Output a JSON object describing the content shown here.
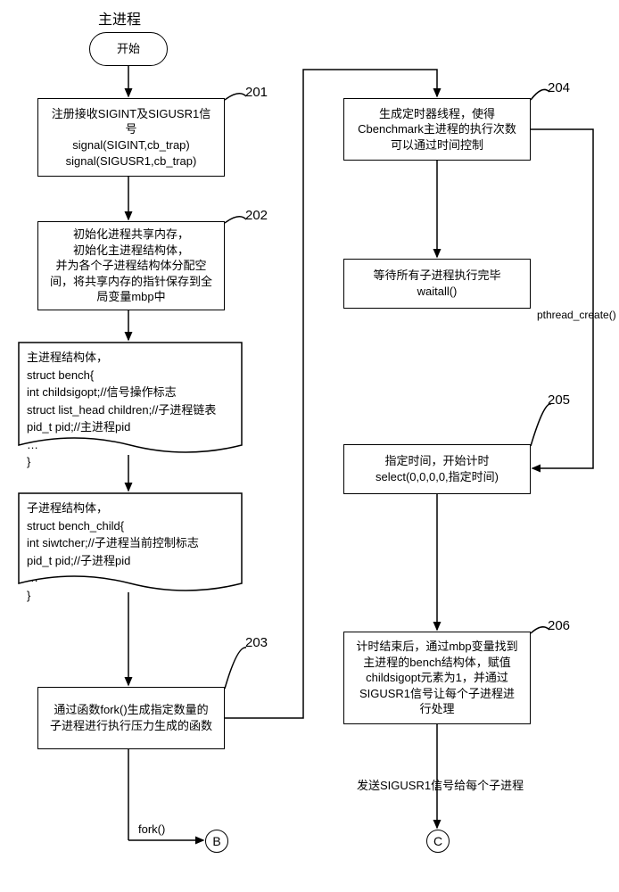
{
  "title": "主进程",
  "start": "开始",
  "steps": {
    "s201": {
      "num": "201",
      "lines": [
        "注册接收SIGINT及SIGUSR1信",
        "号",
        "signal(SIGINT,cb_trap)",
        "signal(SIGUSR1,cb_trap)"
      ]
    },
    "s202": {
      "num": "202",
      "lines": [
        "初始化进程共享内存，",
        "初始化主进程结构体，",
        "并为各个子进程结构体分配空",
        "间，将共享内存的指针保存到全",
        "局变量mbp中"
      ]
    },
    "doc1": {
      "lines": [
        "主进程结构体，",
        "struct bench{",
        "int childsigopt;//信号操作标志",
        "struct list_head children;//子进程链表",
        "pid_t pid;//主进程pid",
        "…",
        "}"
      ]
    },
    "doc2": {
      "lines": [
        "子进程结构体，",
        "struct bench_child{",
        "int siwtcher;//子进程当前控制标志",
        "pid_t pid;//子进程pid",
        "…",
        "}"
      ]
    },
    "s203": {
      "num": "203",
      "lines": [
        "通过函数fork()生成指定数量的",
        "子进程进行执行压力生成的函数"
      ]
    },
    "s204": {
      "num": "204",
      "lines": [
        "生成定时器线程，使得",
        "Cbenchmark主进程的执行次数",
        "可以通过时间控制"
      ]
    },
    "wait": {
      "lines": [
        "等待所有子进程执行完毕",
        "waitall()"
      ]
    },
    "s205": {
      "num": "205",
      "lines": [
        "指定时间，开始计时",
        "select(0,0,0,0,指定时间)"
      ]
    },
    "s206": {
      "num": "206",
      "lines": [
        "计时结束后，通过mbp变量找到",
        "主进程的bench结构体，赋值",
        "childsigopt元素为1，并通过",
        "SIGUSR1信号让每个子进程进",
        "行处理"
      ]
    }
  },
  "side_labels": {
    "pthread": "pthread_create()",
    "fork": "fork()",
    "sendsig": "发送SIGUSR1信号给每个子进程"
  },
  "connectors": {
    "b": "B",
    "c": "C"
  }
}
